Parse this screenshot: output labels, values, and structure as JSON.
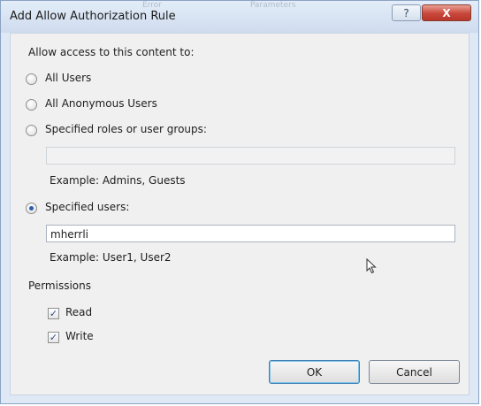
{
  "window": {
    "title": "Add Allow Authorization Rule",
    "help_label": "?",
    "close_label": "X"
  },
  "background_ghost": {
    "text1": "Error",
    "text2": "Parameters"
  },
  "form": {
    "allow_label": "Allow access to this content to:",
    "options": [
      {
        "label": "All Users",
        "selected": false
      },
      {
        "label": "All Anonymous Users",
        "selected": false
      },
      {
        "label": "Specified roles or user groups:",
        "selected": false
      },
      {
        "label": "Specified users:",
        "selected": true
      }
    ],
    "roles_input": {
      "value": "",
      "example": "Example: Admins, Guests"
    },
    "users_input": {
      "value": "mherrli",
      "example": "Example: User1, User2"
    }
  },
  "permissions": {
    "label": "Permissions",
    "items": [
      {
        "label": "Read",
        "checked": true
      },
      {
        "label": "Write",
        "checked": true
      }
    ]
  },
  "buttons": {
    "ok": "OK",
    "cancel": "Cancel"
  },
  "colors": {
    "accent": "#2a5db0",
    "title_bar": "#dfe9f6",
    "close": "#c8473a"
  },
  "icons": {
    "check": "✓",
    "cursor": "mouse-pointer-icon"
  }
}
